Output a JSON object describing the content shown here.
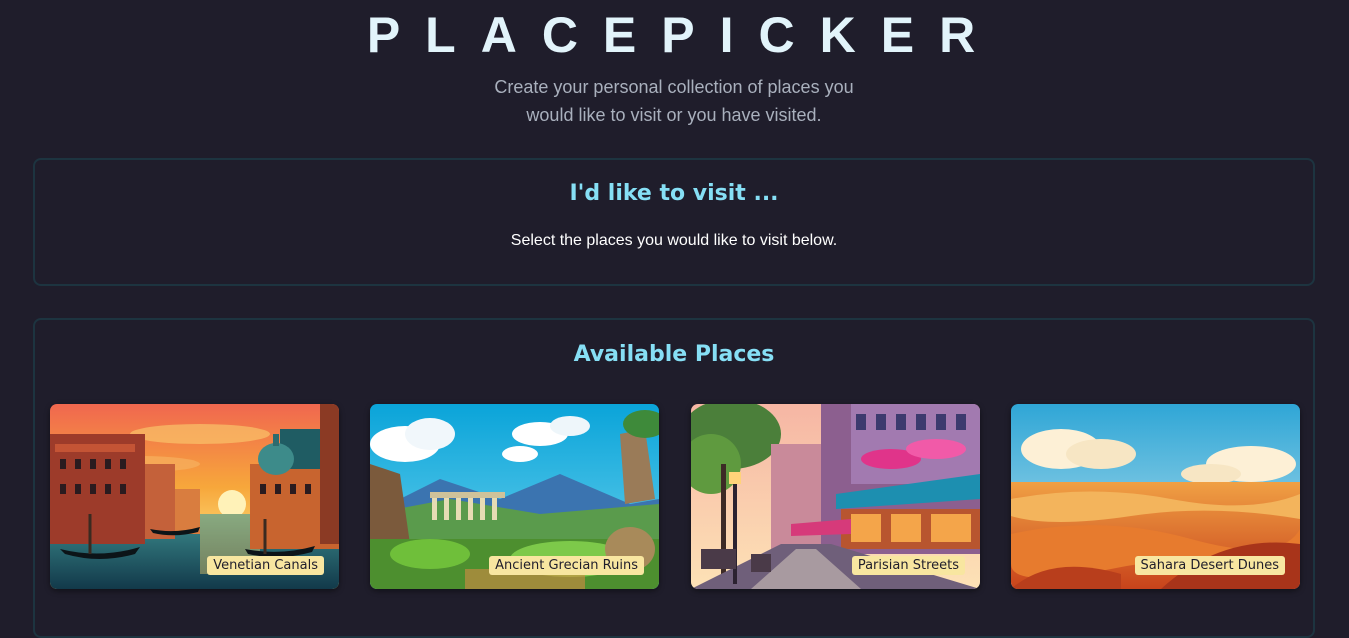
{
  "header": {
    "title": "PLACEPICKER",
    "subtitle": "Create your personal collection of places you would like to visit or you have visited."
  },
  "visit": {
    "heading": "I'd like to visit ...",
    "description": "Select the places you would like to visit below."
  },
  "available": {
    "heading": "Available Places",
    "places": [
      {
        "label": "Venetian Canals"
      },
      {
        "label": "Ancient Grecian Ruins"
      },
      {
        "label": "Parisian Streets"
      },
      {
        "label": "Sahara Desert Dunes"
      }
    ]
  },
  "colors": {
    "background": "#1f1d2b",
    "title": "#e2f4fb",
    "heading_accent": "#86dff5",
    "label_bg": "#f8e6a0",
    "panel_border": "#1d3440"
  }
}
